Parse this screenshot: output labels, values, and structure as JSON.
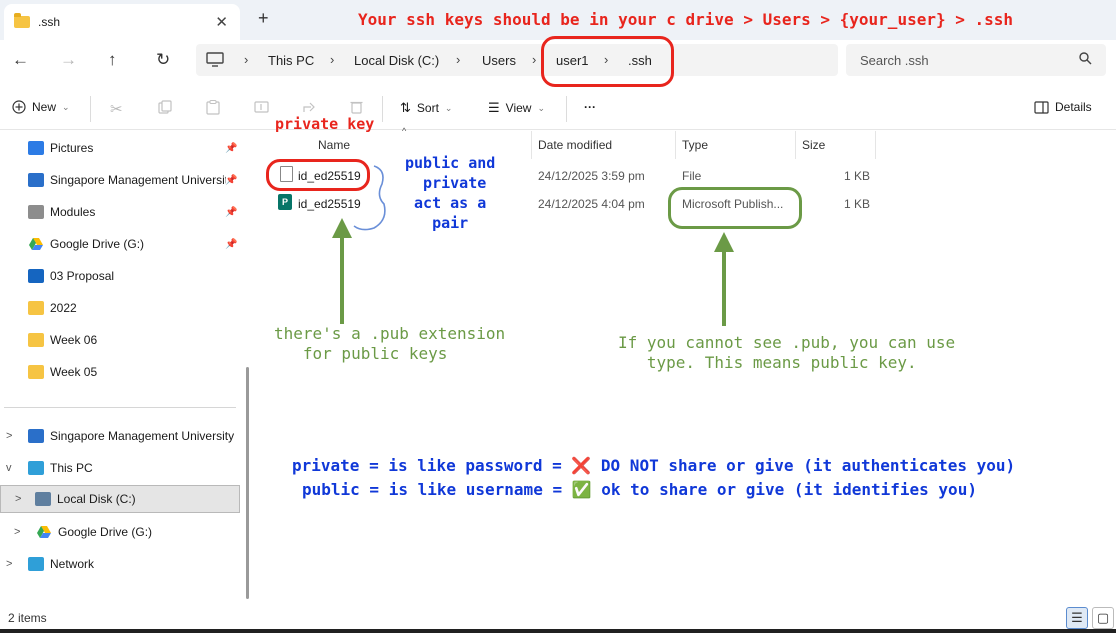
{
  "tab": {
    "title": ".ssh",
    "close": "✕",
    "new": "+"
  },
  "nav": {
    "back": "←",
    "forward": "→",
    "up": "↑",
    "refresh": "↻"
  },
  "breadcrumb": [
    "This PC",
    "Local Disk (C:)",
    "Users",
    "user1",
    ".ssh"
  ],
  "breadcrumb_sep": "›",
  "search": {
    "placeholder": "Search .ssh"
  },
  "commands": {
    "new": "New",
    "sort": "Sort",
    "view": "View",
    "more": "···",
    "details": "Details"
  },
  "sidebar": {
    "pinned": [
      {
        "label": "Pictures",
        "icon": "pictures-icon",
        "color": "#2c7be5"
      },
      {
        "label": "Singapore Management Universit",
        "icon": "building-icon",
        "color": "#2a6fc9"
      },
      {
        "label": "Modules",
        "icon": "folder-icon",
        "color": "#8d8d8d"
      },
      {
        "label": "Google Drive (G:)",
        "icon": "google-drive-icon",
        "color": "#34a853"
      }
    ],
    "recent": [
      {
        "label": "03 Proposal",
        "icon": "folder-icon",
        "color": "#1565c0"
      },
      {
        "label": "2022",
        "icon": "folder-icon",
        "color": "#f6c443"
      },
      {
        "label": "Week 06",
        "icon": "folder-icon",
        "color": "#f6c443"
      },
      {
        "label": "Week 05",
        "icon": "folder-icon",
        "color": "#f6c443"
      }
    ],
    "tree": [
      {
        "label": "Singapore Management University",
        "chevron": ">",
        "icon": "building-icon"
      },
      {
        "label": "This PC",
        "chevron": "v",
        "icon": "computer-icon"
      },
      {
        "label": "Local Disk (C:)",
        "chevron": ">",
        "icon": "disk-icon",
        "selected": true
      },
      {
        "label": "Google Drive (G:)",
        "chevron": ">",
        "icon": "google-drive-icon"
      },
      {
        "label": "Network",
        "chevron": ">",
        "icon": "network-icon"
      }
    ]
  },
  "columns": [
    "Name",
    "Date modified",
    "Type",
    "Size"
  ],
  "files": [
    {
      "name": "id_ed25519",
      "date": "24/12/2025 3:59 pm",
      "type": "File",
      "size": "1 KB",
      "icon": "file-icon"
    },
    {
      "name": "id_ed25519",
      "date": "24/12/2025 4:04 pm",
      "type": "Microsoft Publish...",
      "size": "1 KB",
      "icon": "publisher-icon"
    }
  ],
  "status": {
    "count": "2 items"
  },
  "annotations": {
    "top": "Your ssh keys should be in your c drive > Users > {your_user} > .ssh",
    "private_key": "private key",
    "pair": "public and\n  private\n act as a\n   pair",
    "pub_ext": "there's a .pub extension\n   for public keys",
    "type_hint": "If you cannot see .pub, you can use\n   type. This means public key.",
    "private_line": "private = is like password = ❌ DO NOT share or give (it authenticates you)",
    "public_line": "public = is like username = ✅ ok to share or give (it identifies you)"
  }
}
